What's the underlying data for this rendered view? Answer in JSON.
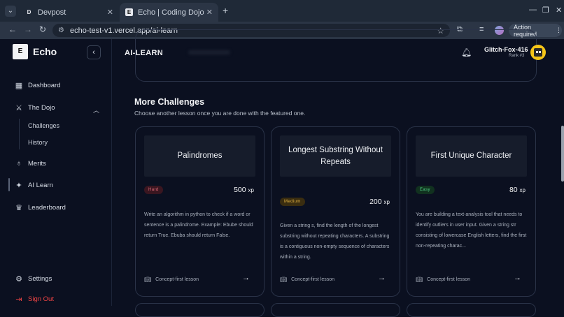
{
  "browser": {
    "tabs": [
      {
        "favicon": "D",
        "title": "Devpost"
      },
      {
        "favicon": "E",
        "title": "Echo | Coding Dojo and C"
      }
    ],
    "url": "echo-test-v1.vercel.app/ai-learn",
    "action_required": "Action required"
  },
  "sidebar": {
    "logo_letter": "E",
    "app_name": "Echo",
    "items": [
      {
        "icon": "dashboard-icon",
        "label": "Dashboard"
      },
      {
        "icon": "sword-icon",
        "label": "The Dojo"
      },
      {
        "icon": "medal-icon",
        "label": "Merits"
      },
      {
        "icon": "sparkles-icon",
        "label": "AI Learn"
      },
      {
        "icon": "trophy-icon",
        "label": "Leaderboard"
      }
    ],
    "sub_items": [
      "Challenges",
      "History"
    ],
    "settings": "Settings",
    "sign_out": "Sign Out"
  },
  "header": {
    "title": "AI-LEARN",
    "user_name": "Glitch-Fox-416",
    "user_rank": "Rank #3"
  },
  "section": {
    "title": "More Challenges",
    "subtitle": "Choose another lesson once you are done with the featured one."
  },
  "cards": [
    {
      "title": "Palindromes",
      "difficulty": "Hard",
      "xp": "500",
      "xp_unit": "xp",
      "description": "Write an algorithm in python to check if a word or sentence is a palindrome. Example: Ebube should return True. Ebuba should return False.",
      "footer": "Concept-first lesson"
    },
    {
      "title": "Longest Substring Without Repeats",
      "difficulty": "Medium",
      "xp": "200",
      "xp_unit": "xp",
      "description": "Given a string s, find the length of the longest substring without repeating characters. A substring is a contiguous non-empty sequence of characters within a string.",
      "footer": "Concept-first lesson"
    },
    {
      "title": "First Unique Character",
      "difficulty": "Easy",
      "xp": "80",
      "xp_unit": "xp",
      "description": "You are building a text-analysis tool that needs to identify outliers in user input. Given a string str consisting of lowercase English letters, find the first non-repeating charac...",
      "footer": "Concept-first lesson"
    }
  ]
}
